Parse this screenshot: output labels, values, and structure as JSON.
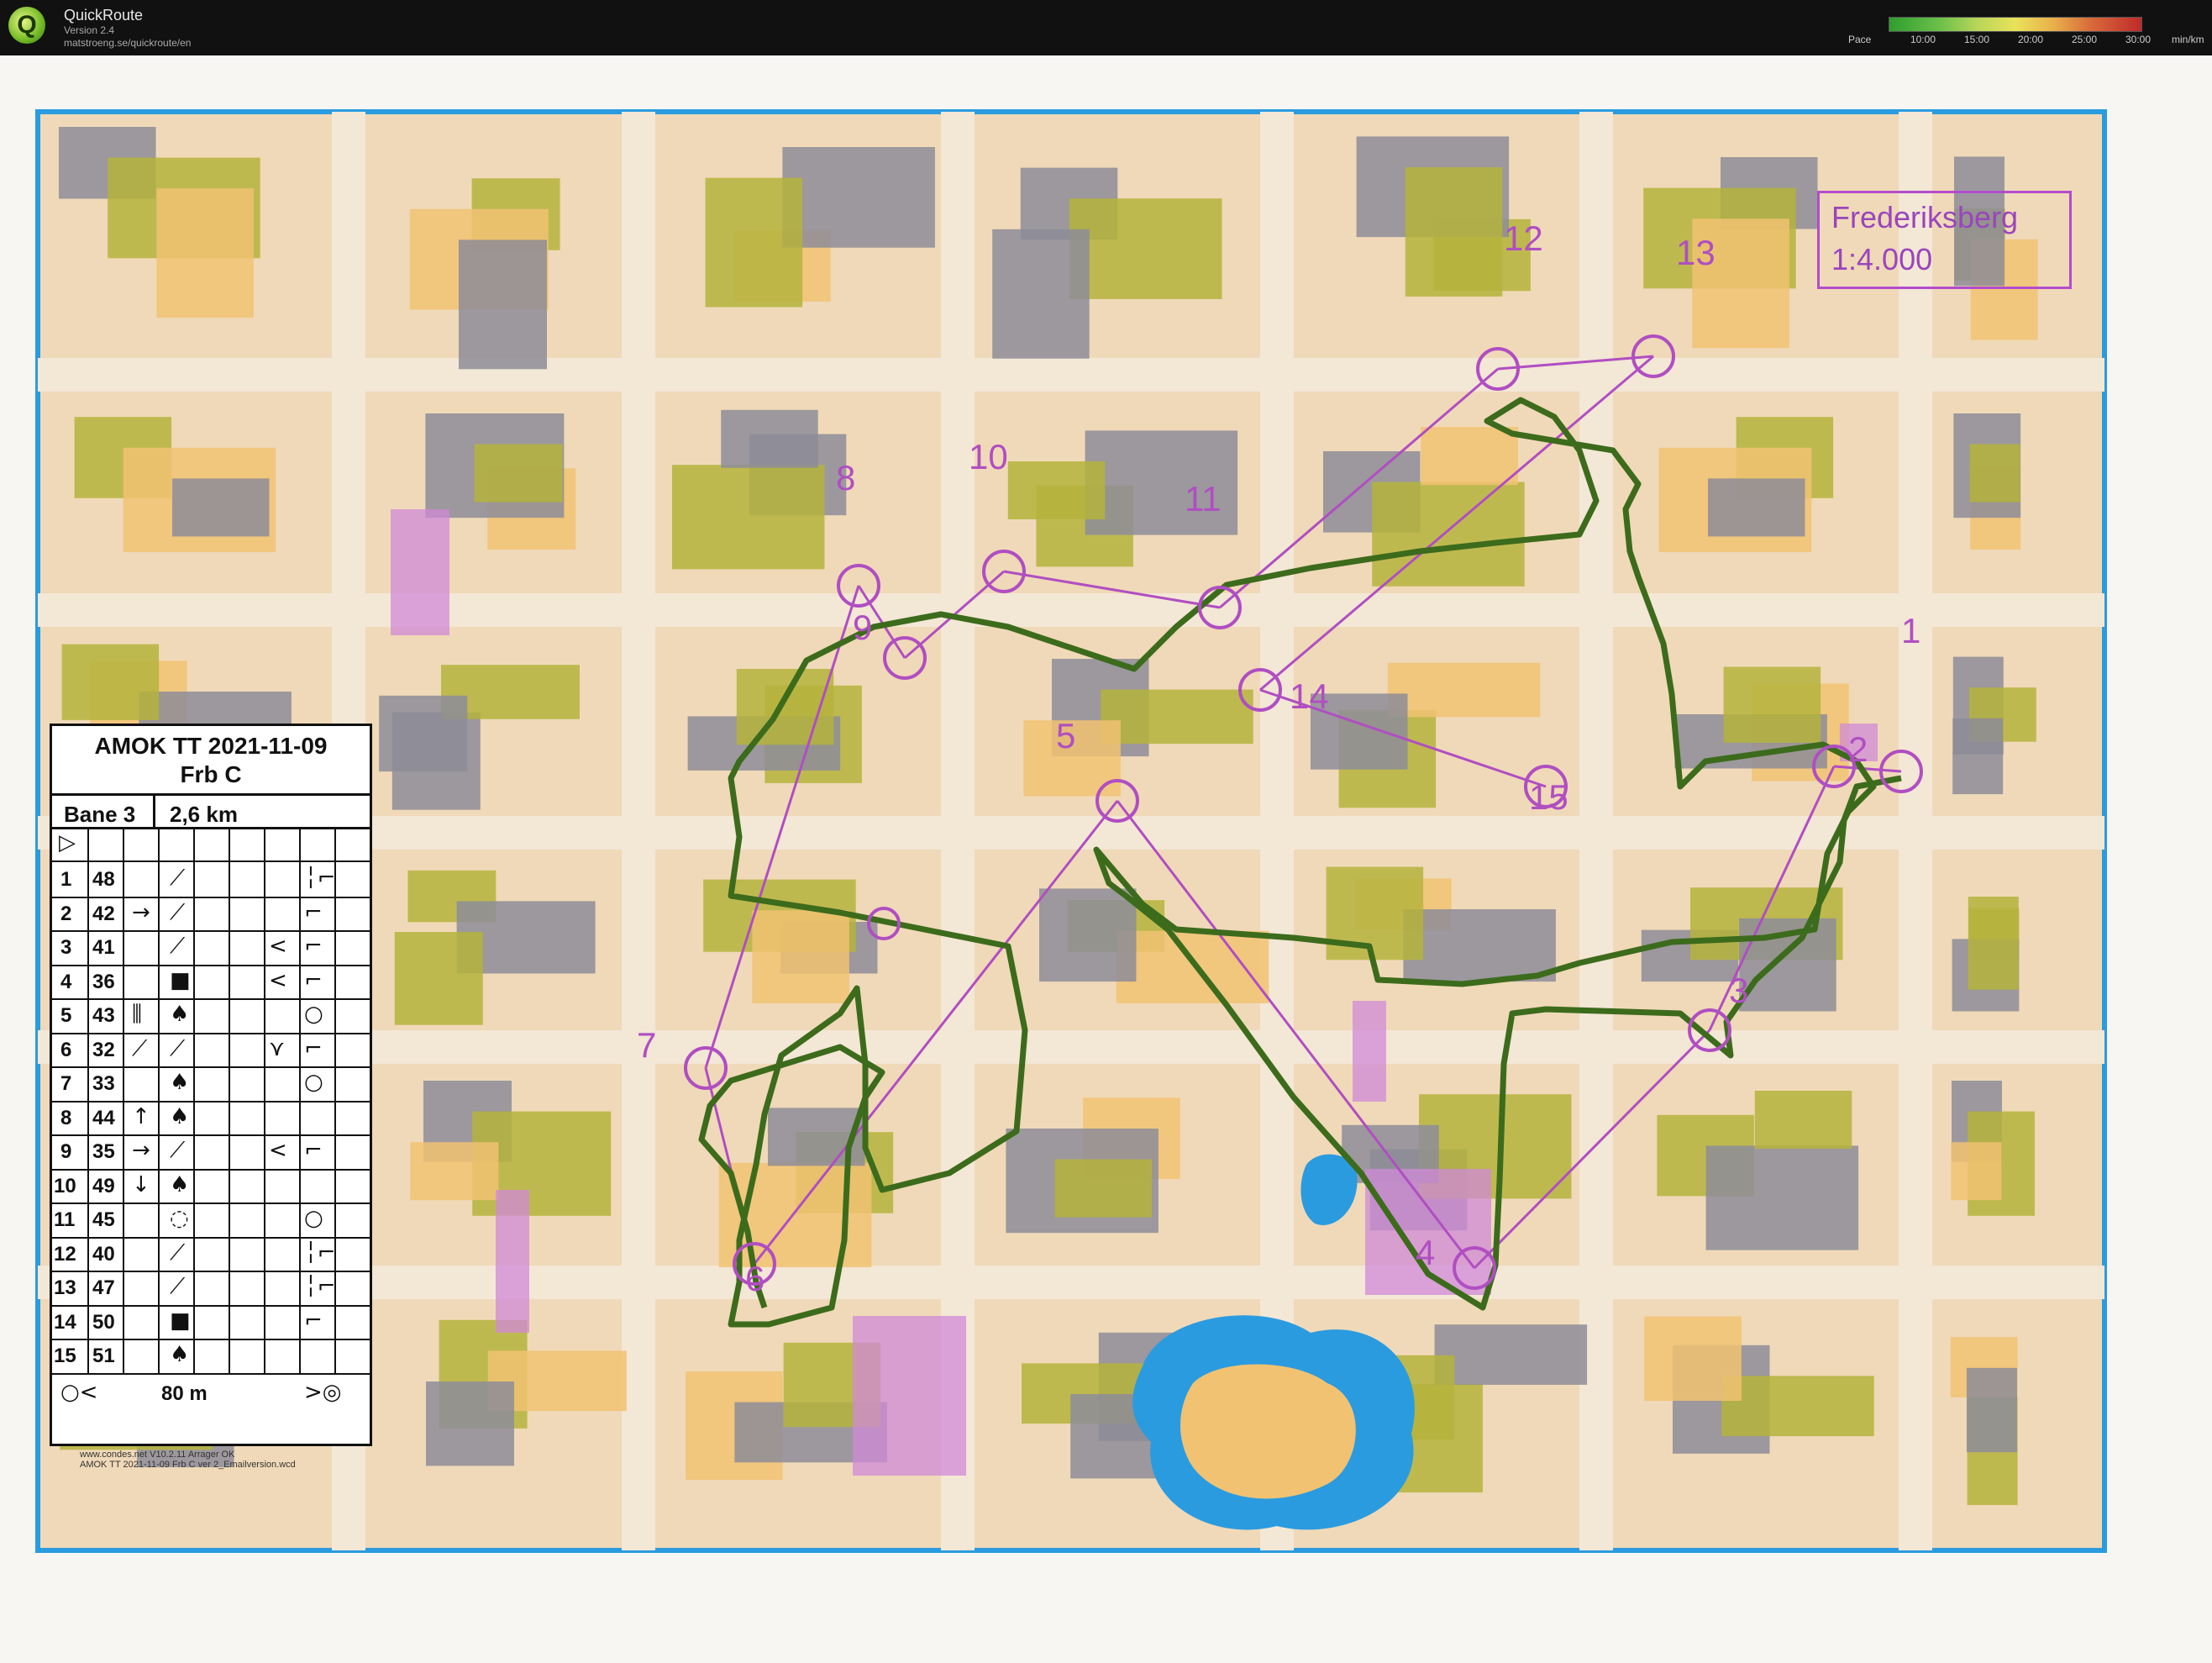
{
  "app": {
    "logo_letter": "Q",
    "name": "QuickRoute",
    "version": "Version 2.4",
    "url": "matstroeng.se/quickroute/en"
  },
  "pace_legend": {
    "label": "Pace",
    "ticks": [
      "10:00",
      "15:00",
      "20:00",
      "25:00",
      "30:00"
    ],
    "unit": "min/km"
  },
  "map": {
    "title_line1": "Frederiksberg",
    "title_line2": "1:4.000",
    "course_color": "#b04ec2",
    "route_color": "#3c6b1c",
    "water_color": "#2b9be0",
    "building_color": "#8d8c98",
    "veg_color": "#b5b33c",
    "open_color": "#f1c272"
  },
  "card": {
    "title": "AMOK TT 2021-11-09",
    "subtitle": "Frb C",
    "course": "Bane 3",
    "length": "2,6 km",
    "start_symbol": "▷",
    "finish_left": "○<",
    "finish_distance": "80 m",
    "finish_right": ">◎",
    "rows": [
      {
        "n": "1",
        "code": "48",
        "d": "",
        "f": "⟋",
        "g": "",
        "h": "╎⌐"
      },
      {
        "n": "2",
        "code": "42",
        "d": "→",
        "f": "⟋",
        "g": "",
        "h": "⌐"
      },
      {
        "n": "3",
        "code": "41",
        "d": "",
        "f": "⟋",
        "g": "<",
        "h": "⌐"
      },
      {
        "n": "4",
        "code": "36",
        "d": "",
        "f": "■",
        "g": "<",
        "h": "⌐"
      },
      {
        "n": "5",
        "code": "43",
        "d": "⫼",
        "f": "♠",
        "g": "",
        "h": "○"
      },
      {
        "n": "6",
        "code": "32",
        "d": "⟋",
        "f": "⟋",
        "g": "⋎",
        "h": "⌐"
      },
      {
        "n": "7",
        "code": "33",
        "d": "",
        "f": "♠",
        "g": "",
        "h": "○"
      },
      {
        "n": "8",
        "code": "44",
        "d": "↑",
        "f": "♠",
        "g": "",
        "h": ""
      },
      {
        "n": "9",
        "code": "35",
        "d": "→",
        "f": "⟋",
        "g": "<",
        "h": "⌐"
      },
      {
        "n": "10",
        "code": "49",
        "d": "↓",
        "f": "♠",
        "g": "",
        "h": ""
      },
      {
        "n": "11",
        "code": "45",
        "d": "",
        "f": "◌",
        "g": "",
        "h": "○"
      },
      {
        "n": "12",
        "code": "40",
        "d": "",
        "f": "⟋",
        "g": "",
        "h": "╎⌐"
      },
      {
        "n": "13",
        "code": "47",
        "d": "",
        "f": "⟋",
        "g": "",
        "h": "╎⌐"
      },
      {
        "n": "14",
        "code": "50",
        "d": "",
        "f": "■",
        "g": "",
        "h": "⌐"
      },
      {
        "n": "15",
        "code": "51",
        "d": "",
        "f": "♠",
        "g": "",
        "h": ""
      }
    ]
  },
  "controls": [
    {
      "n": "1"
    },
    {
      "n": "2"
    },
    {
      "n": "3"
    },
    {
      "n": "4"
    },
    {
      "n": "5"
    },
    {
      "n": "6"
    },
    {
      "n": "7"
    },
    {
      "n": "8"
    },
    {
      "n": "9"
    },
    {
      "n": "10"
    },
    {
      "n": "11"
    },
    {
      "n": "12"
    },
    {
      "n": "13"
    },
    {
      "n": "14"
    },
    {
      "n": "15"
    }
  ],
  "footer": {
    "line1": "www.condes.net V10.2.11 Arrager OK",
    "line2": "AMOK TT 2021-11-09 Frb C ver 2_Emailversion.wcd"
  }
}
